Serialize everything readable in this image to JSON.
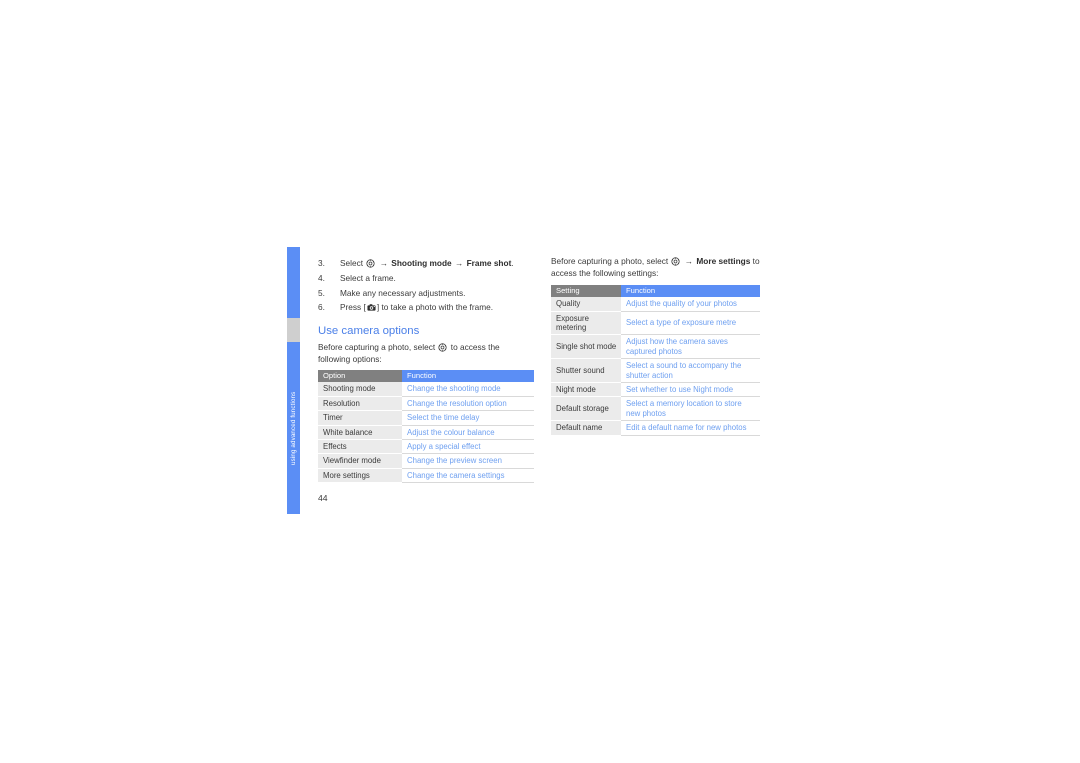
{
  "sidebar": {
    "tab_label": "using advanced functions"
  },
  "page_number": "44",
  "left_column": {
    "steps": [
      {
        "num": "3.",
        "parts": [
          {
            "t": "Select "
          },
          {
            "icon": "camera-settings-gear-icon"
          },
          {
            "t": " "
          },
          {
            "arrow": "→"
          },
          {
            "t": " "
          },
          {
            "t": "Shooting mode",
            "bold": true
          },
          {
            "t": " "
          },
          {
            "arrow": "→"
          },
          {
            "t": " "
          },
          {
            "t": "Frame shot",
            "bold": true
          },
          {
            "t": "."
          }
        ],
        "plain": "3. Select (settings) → Shooting mode → Frame shot."
      },
      {
        "num": "4.",
        "plain_text": "Select a frame."
      },
      {
        "num": "5.",
        "plain_text": "Make any necessary adjustments."
      },
      {
        "num": "6.",
        "parts": [
          {
            "t": "Press ["
          },
          {
            "icon": "camera-key-icon"
          },
          {
            "t": "] to take a photo with the frame."
          }
        ],
        "plain": "6. Press [camera] to take a photo with the frame."
      }
    ],
    "heading": "Use camera options",
    "intro_before": "Before capturing a photo, select",
    "intro_after": "to access the following options:",
    "table": {
      "headers": [
        "Option",
        "Function"
      ],
      "rows": [
        [
          "Shooting mode",
          "Change the shooting mode"
        ],
        [
          "Resolution",
          "Change the resolution option"
        ],
        [
          "Timer",
          "Select the time delay"
        ],
        [
          "White balance",
          "Adjust the colour balance"
        ],
        [
          "Effects",
          "Apply a special effect"
        ],
        [
          "Viewfinder mode",
          "Change the preview screen"
        ],
        [
          "More settings",
          "Change the camera settings"
        ]
      ]
    }
  },
  "right_column": {
    "intro_before": "Before capturing a photo, select",
    "intro_mid": "More settings",
    "intro_after": "to access the following settings:",
    "table": {
      "headers": [
        "Setting",
        "Function"
      ],
      "rows": [
        [
          "Quality",
          "Adjust the quality of your photos"
        ],
        [
          "Exposure metering",
          "Select a type of exposure metre"
        ],
        [
          "Single shot mode",
          "Adjust how the camera saves captured photos"
        ],
        [
          "Shutter sound",
          "Select a sound to accompany the shutter action"
        ],
        [
          "Night mode",
          "Set whether to use Night mode"
        ],
        [
          "Default storage",
          "Select a memory location to store new photos"
        ],
        [
          "Default name",
          "Edit a default name for new photos"
        ]
      ]
    }
  },
  "colors": {
    "accent_blue": "#5b8ef5",
    "heading_blue": "#4a7fe8",
    "link_blue": "#6fa0f0",
    "header_gray": "#808080",
    "cell_gray": "#ebebeb",
    "body_text": "#3b3b3b"
  },
  "icons": {
    "gear": "camera-settings-gear-icon",
    "camera": "camera-key-icon",
    "arrow": "→"
  }
}
